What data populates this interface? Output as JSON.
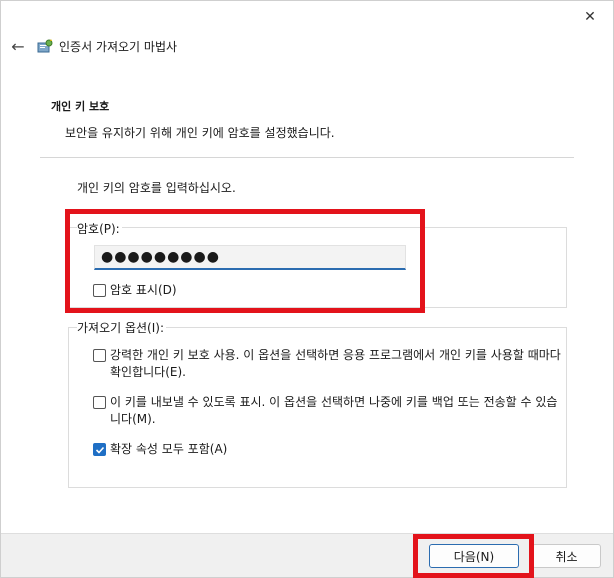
{
  "window": {
    "title": "인증서 가져오기 마법사",
    "close_glyph": "✕",
    "back_glyph": "←"
  },
  "header": {
    "title": "개인 키 보호",
    "subtitle": "보안을 유지하기 위해 개인 키에 암호를 설정했습니다."
  },
  "prompt": "개인 키의 암호를 입력하십시오.",
  "password": {
    "label": "암호(P):",
    "value": "●●●●●●●●●",
    "show_checkbox": {
      "label": "암호 표시(D)",
      "checked": false
    }
  },
  "import_options": {
    "legend": "가져오기 옵션(I):",
    "items": [
      {
        "label": "강력한 개인 키 보호 사용. 이 옵션을 선택하면 응용 프로그램에서 개인 키를 사용할 때마다 확인합니다(E).",
        "checked": false
      },
      {
        "label": "이 키를 내보낼 수 있도록 표시. 이 옵션을 선택하면 나중에 키를 백업 또는 전송할 수 있습니다(M).",
        "checked": false
      },
      {
        "label": "확장 속성 모두 포함(A)",
        "checked": true
      }
    ]
  },
  "footer": {
    "next_label": "다음(N)",
    "cancel_label": "취소"
  },
  "colors": {
    "accent": "#1f6fc5",
    "highlight": "#e3131b"
  }
}
